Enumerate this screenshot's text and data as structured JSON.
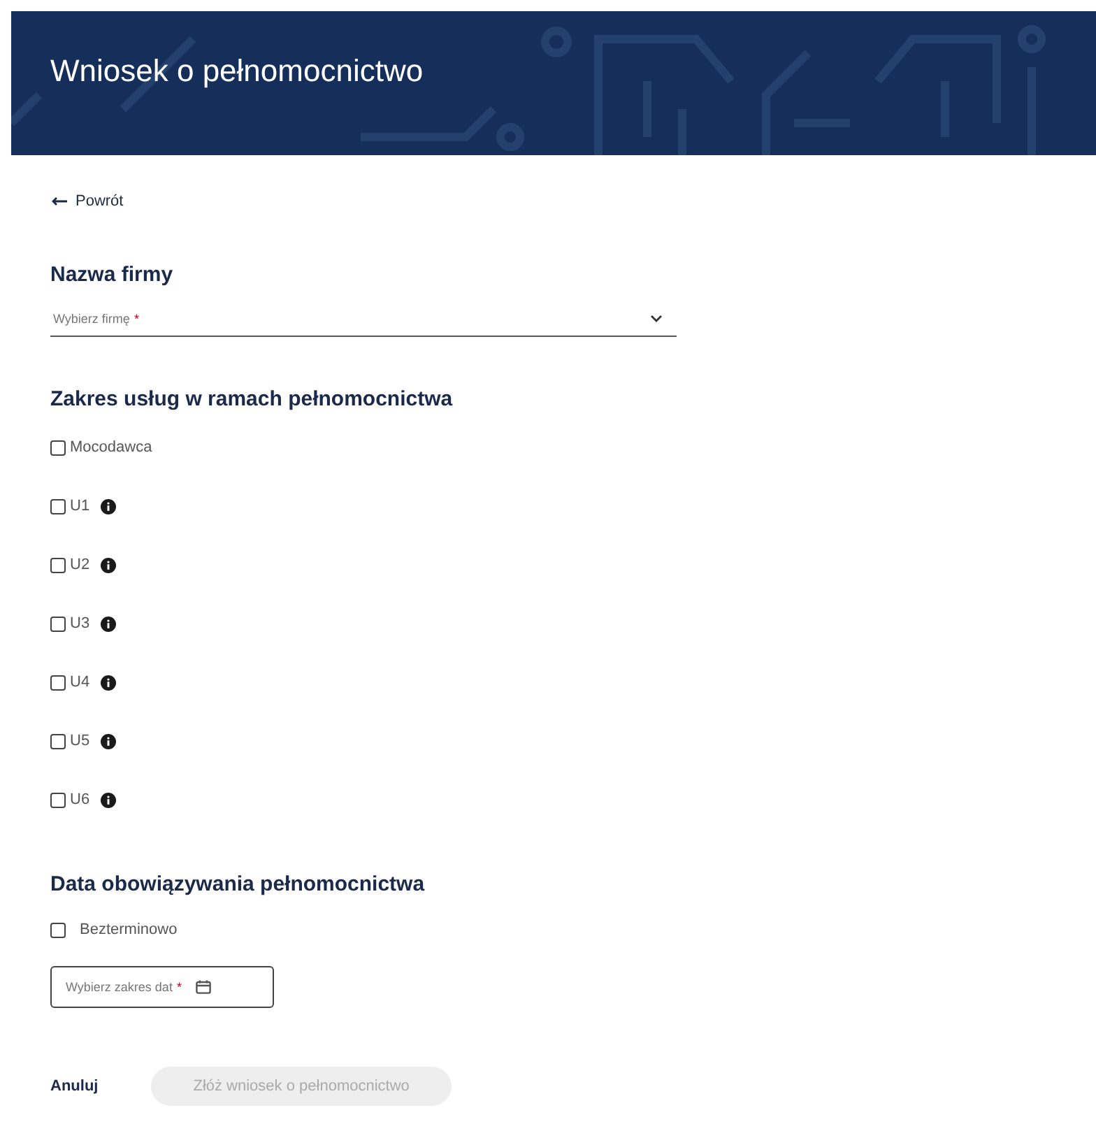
{
  "header": {
    "title": "Wniosek o pełnomocnictwo"
  },
  "back_link": {
    "label": "Powrót"
  },
  "company_section": {
    "heading": "Nazwa firmy",
    "select": {
      "placeholder": "Wybierz firmę",
      "required_mark": "*"
    }
  },
  "scope_section": {
    "heading": "Zakres usług w ramach pełnomocnictwa",
    "options": [
      {
        "label": "Mocodawca",
        "checked": false,
        "info": false
      },
      {
        "label": "U1",
        "checked": false,
        "info": true
      },
      {
        "label": "U2",
        "checked": false,
        "info": true
      },
      {
        "label": "U3",
        "checked": false,
        "info": true
      },
      {
        "label": "U4",
        "checked": false,
        "info": true
      },
      {
        "label": "U5",
        "checked": false,
        "info": true
      },
      {
        "label": "U6",
        "checked": false,
        "info": true
      }
    ]
  },
  "date_section": {
    "heading": "Data obowiązywania pełnomocnictwa",
    "indefinite": {
      "label": "Bezterminowo",
      "checked": false
    },
    "date_range": {
      "placeholder": "Wybierz zakres dat",
      "required_mark": "*"
    }
  },
  "actions": {
    "cancel": "Anuluj",
    "submit": {
      "label": "Złóż wniosek o pełnomocnictwo",
      "disabled": true
    }
  }
}
